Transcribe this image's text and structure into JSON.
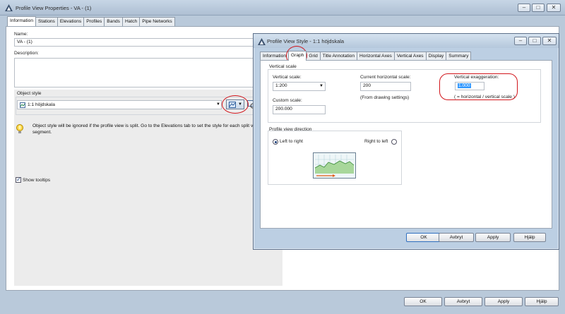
{
  "main_window": {
    "title": "Profile View Properties - VA - (1)",
    "tabs": [
      "Information",
      "Stations",
      "Elevations",
      "Profiles",
      "Bands",
      "Hatch",
      "Pipe Networks"
    ],
    "active_tab": "Information",
    "name_label": "Name:",
    "name_value": "VA - (1)",
    "description_label": "Description:",
    "description_value": "",
    "object_style_label": "Object style",
    "object_style_value": "1:1 höjdskala",
    "info_message": "Object style will be ignored if the profile view is split. Go to the Elevations tab to set the style for each split view segment.",
    "show_tooltips_label": "Show tooltips",
    "show_tooltips_checked": true,
    "buttons": {
      "ok": "OK",
      "cancel": "Avbryt",
      "apply": "Apply",
      "help": "Hjälp"
    }
  },
  "dialog": {
    "title": "Profile View Style - 1:1 höjdskala",
    "tabs": [
      "Information",
      "Graph",
      "Grid",
      "Title Annotation",
      "Horizontal Axes",
      "Vertical Axes",
      "Display",
      "Summary"
    ],
    "active_tab": "Graph",
    "vertical_scale_group": "Vertical scale",
    "vertical_scale_label": "Vertical scale:",
    "vertical_scale_value": "1:200",
    "custom_scale_label": "Custom scale:",
    "custom_scale_value": "200.000",
    "current_horizontal_scale_label": "Current horizontal scale:",
    "current_horizontal_scale_value": "200",
    "from_drawing_settings": "(From drawing settings)",
    "vertical_exaggeration_label": "Vertical exaggeration:",
    "vertical_exaggeration_value": "1.000",
    "exaggeration_note": "( = horizontal / vertical scale )",
    "direction_group": "Profile view direction",
    "left_to_right_label": "Left to right",
    "right_to_left_label": "Right to left",
    "direction_selected": "Left to right",
    "buttons": {
      "ok": "OK",
      "cancel": "Avbryt",
      "apply": "Apply",
      "help": "Hjälp"
    }
  },
  "colors": {
    "highlight_ring": "#d1151b",
    "selection": "#3399ff",
    "title_bar": "#bfd0e2"
  },
  "icons": [
    "autocad-app-icon",
    "minimize-icon",
    "maximize-icon",
    "close-icon",
    "style-edit-icon",
    "dropdown-arrow-icon",
    "pick-from-drawing-icon",
    "info-bulb-icon",
    "profile-preview-icon"
  ]
}
